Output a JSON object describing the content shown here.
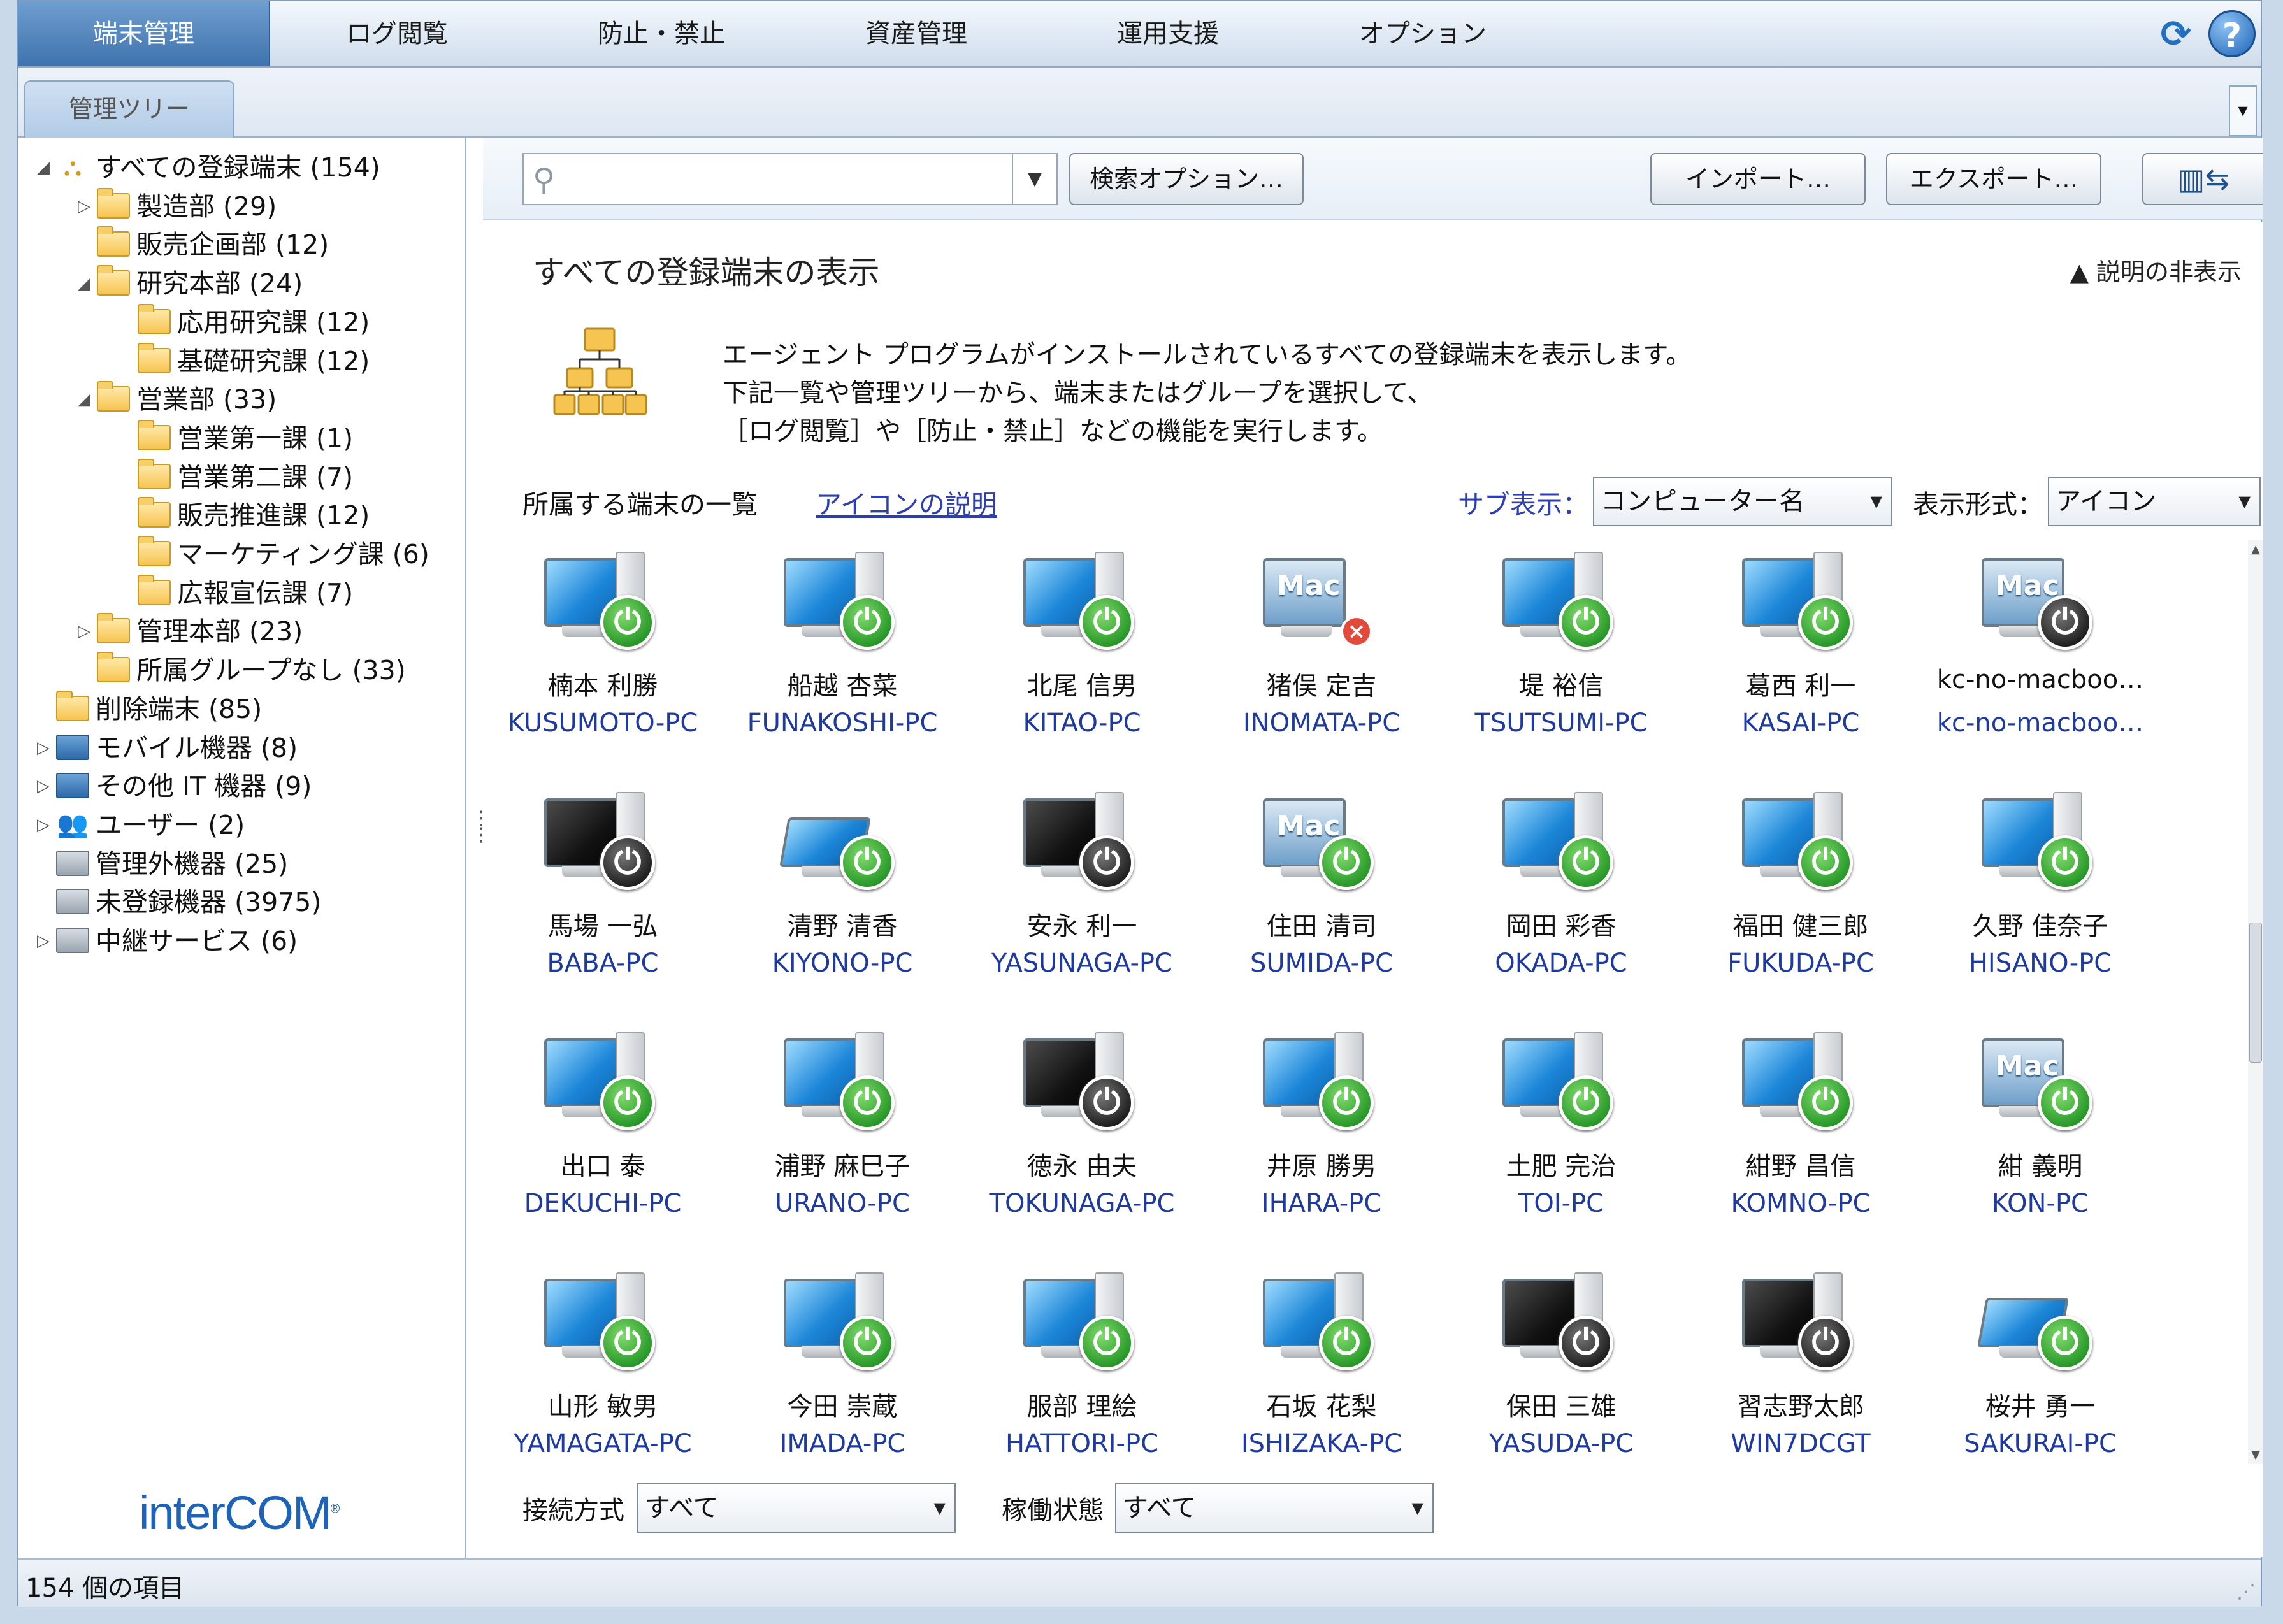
{
  "menu": {
    "items": [
      "端末管理",
      "ログ閲覧",
      "防止・禁止",
      "資産管理",
      "運用支援",
      "オプション"
    ],
    "active": "端末管理"
  },
  "tabs": {
    "tree_tab": "管理ツリー"
  },
  "tree": {
    "rows": [
      {
        "label": "すべての登録端末 (154)",
        "icon": "org-chart-icon",
        "toggle": "◢"
      },
      {
        "label": "製造部 (29)",
        "icon": "folder-icon",
        "toggle": "▷"
      },
      {
        "label": "販売企画部 (12)",
        "icon": "folder-icon",
        "toggle": ""
      },
      {
        "label": "研究本部 (24)",
        "icon": "folder-icon",
        "toggle": "◢"
      },
      {
        "label": "応用研究課 (12)",
        "icon": "folder-icon",
        "toggle": ""
      },
      {
        "label": "基礎研究課 (12)",
        "icon": "folder-icon",
        "toggle": ""
      },
      {
        "label": "営業部 (33)",
        "icon": "folder-icon",
        "toggle": "◢"
      },
      {
        "label": "営業第一課 (1)",
        "icon": "folder-icon",
        "toggle": ""
      },
      {
        "label": "営業第二課 (7)",
        "icon": "folder-icon",
        "toggle": ""
      },
      {
        "label": "販売推進課 (12)",
        "icon": "folder-icon",
        "toggle": ""
      },
      {
        "label": "マーケティング課 (6)",
        "icon": "folder-icon",
        "toggle": ""
      },
      {
        "label": "広報宣伝課 (7)",
        "icon": "folder-icon",
        "toggle": ""
      },
      {
        "label": "管理本部 (23)",
        "icon": "folder-icon",
        "toggle": "▷"
      },
      {
        "label": "所属グループなし (33)",
        "icon": "folder-info-icon",
        "toggle": ""
      },
      {
        "label": "削除端末 (85)",
        "icon": "deleted-folder-icon",
        "toggle": ""
      },
      {
        "label": "モバイル機器 (8)",
        "icon": "mobile-device-icon",
        "toggle": "▷"
      },
      {
        "label": "その他 IT 機器 (9)",
        "icon": "network-device-icon",
        "toggle": "▷"
      },
      {
        "label": "ユーザー (2)",
        "icon": "users-icon",
        "toggle": "▷"
      },
      {
        "label": "管理外機器 (25)",
        "icon": "unmanaged-device-icon",
        "toggle": ""
      },
      {
        "label": "未登録機器 (3975)",
        "icon": "unregistered-device-icon",
        "toggle": ""
      },
      {
        "label": "中継サービス (6)",
        "icon": "relay-server-icon",
        "toggle": "▷"
      }
    ]
  },
  "logo": {
    "text": "interCOM",
    "mark": "®"
  },
  "toolbar": {
    "search_value": "",
    "search_options": "検索オプション…",
    "import": "インポート…",
    "export": "エクスポート…"
  },
  "content": {
    "title": "すべての登録端末の表示",
    "hide_desc": "▲ 説明の非表示",
    "desc_lines": [
      "エージェント プログラムがインストールされているすべての登録端末を表示します。",
      "下記一覧や管理ツリーから、端末またはグループを選択して、",
      "［ログ閲覧］や［防止・禁止］などの機能を実行します。"
    ],
    "list_label": "所属する端末の一覧",
    "icon_help": "アイコンの説明",
    "sub_view_label": "サブ表示：",
    "sub_view_value": "コンピューター名",
    "view_format_label": "表示形式：",
    "view_format_value": "アイコン",
    "connection_label": "接続方式",
    "connection_value": "すべて",
    "status_label": "稼働状態",
    "status_value": "すべて"
  },
  "devices": [
    {
      "user": "楠本 利勝",
      "host": "KUSUMOTO-PC",
      "type": "desktop",
      "status": "on"
    },
    {
      "user": "船越 杏菜",
      "host": "FUNAKOSHI-PC",
      "type": "desktop",
      "status": "on"
    },
    {
      "user": "北尾 信男",
      "host": "KITAO-PC",
      "type": "desktop",
      "status": "on"
    },
    {
      "user": "猪俣 定吉",
      "host": "INOMATA-PC",
      "type": "mac",
      "status": "error"
    },
    {
      "user": "堤 裕信",
      "host": "TSUTSUMI-PC",
      "type": "desktop",
      "status": "on"
    },
    {
      "user": "葛西 利一",
      "host": "KASAI-PC",
      "type": "desktop",
      "status": "on"
    },
    {
      "user": "kc-no-macboo…",
      "host": "kc-no-macboo…",
      "type": "mac-black",
      "status": "off"
    },
    {
      "user": "馬場 一弘",
      "host": "BABA-PC",
      "type": "black",
      "status": "off"
    },
    {
      "user": "清野 清香",
      "host": "KIYONO-PC",
      "type": "laptop",
      "status": "on"
    },
    {
      "user": "安永 利一",
      "host": "YASUNAGA-PC",
      "type": "black",
      "status": "off"
    },
    {
      "user": "住田 清司",
      "host": "SUMIDA-PC",
      "type": "mac",
      "status": "on"
    },
    {
      "user": "岡田 彩香",
      "host": "OKADA-PC",
      "type": "desktop",
      "status": "on"
    },
    {
      "user": "福田 健三郎",
      "host": "FUKUDA-PC",
      "type": "desktop",
      "status": "on"
    },
    {
      "user": "久野 佳奈子",
      "host": "HISANO-PC",
      "type": "desktop",
      "status": "on"
    },
    {
      "user": "出口 泰",
      "host": "DEKUCHI-PC",
      "type": "desktop",
      "status": "on"
    },
    {
      "user": "浦野 麻巳子",
      "host": "URANO-PC",
      "type": "desktop",
      "status": "on"
    },
    {
      "user": "徳永 由夫",
      "host": "TOKUNAGA-PC",
      "type": "black",
      "status": "off"
    },
    {
      "user": "井原 勝男",
      "host": "IHARA-PC",
      "type": "desktop",
      "status": "on"
    },
    {
      "user": "土肥 完治",
      "host": "TOI-PC",
      "type": "desktop",
      "status": "on"
    },
    {
      "user": "紺野 昌信",
      "host": "KOMNO-PC",
      "type": "desktop",
      "status": "on"
    },
    {
      "user": "紺 義明",
      "host": "KON-PC",
      "type": "mac",
      "status": "on"
    },
    {
      "user": "山形 敏男",
      "host": "YAMAGATA-PC",
      "type": "desktop",
      "status": "on"
    },
    {
      "user": "今田 崇蔵",
      "host": "IMADA-PC",
      "type": "desktop",
      "status": "on"
    },
    {
      "user": "服部 理絵",
      "host": "HATTORI-PC",
      "type": "desktop",
      "status": "on"
    },
    {
      "user": "石坂 花梨",
      "host": "ISHIZAKA-PC",
      "type": "desktop",
      "status": "on"
    },
    {
      "user": "保田 三雄",
      "host": "YASUDA-PC",
      "type": "black",
      "status": "off"
    },
    {
      "user": "習志野太郎",
      "host": "WIN7DCGT",
      "type": "black",
      "status": "off"
    },
    {
      "user": "桜井 勇一",
      "host": "SAKURAI-PC",
      "type": "laptop",
      "status": "on"
    }
  ],
  "statusbar": {
    "text": "154 個の項目"
  },
  "colors": {
    "accent": "#3f73ad",
    "link": "#1f3a9e",
    "online": "#2a9a2a",
    "error": "#e24a3b"
  }
}
